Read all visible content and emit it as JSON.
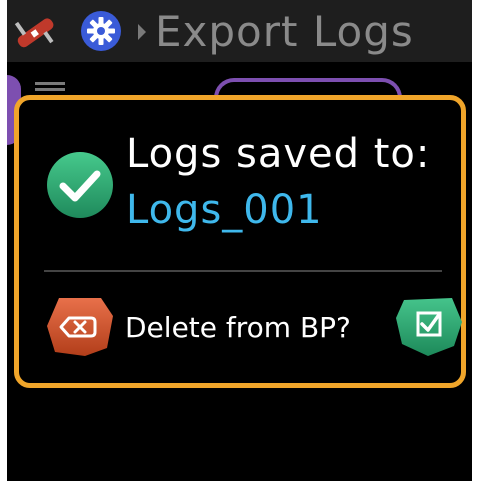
{
  "header": {
    "title": "Export Logs",
    "tool_icon": "swiss-knife-icon",
    "settings_icon": "gear-icon"
  },
  "dialog": {
    "message": "Logs saved to:",
    "folder": "Logs_001",
    "question": "Delete from BP?",
    "success_icon": "checkmark-icon",
    "cancel_icon": "backspace-icon",
    "confirm_icon": "checkbox-icon"
  },
  "colors": {
    "accent_border": "#f0a52a",
    "link_blue": "#3fb8ec",
    "success_green": "#2fae7a",
    "delete_red": "#d4552a",
    "confirm_green": "#2fa777"
  }
}
